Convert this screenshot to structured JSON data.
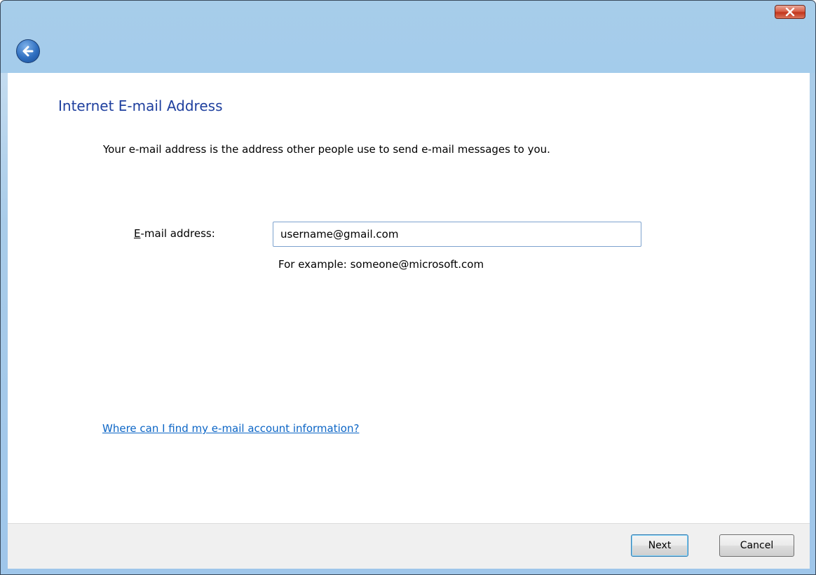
{
  "window": {
    "close_icon": "close-icon",
    "back_icon": "back-arrow-icon"
  },
  "page": {
    "heading": "Internet E-mail Address",
    "description": "Your e-mail address is the address other people use to send e-mail messages to you."
  },
  "form": {
    "email_label": "E-mail address:",
    "email_value": "username@gmail.com",
    "example": "For example: someone@microsoft.com"
  },
  "help": {
    "link_text": "Where can I find my e-mail account information?"
  },
  "buttons": {
    "next_label": "Next",
    "cancel_label": "Cancel"
  },
  "colors": {
    "heading": "#1e3f9e",
    "link": "#0b65c6",
    "frame": "#9ec9ee"
  }
}
